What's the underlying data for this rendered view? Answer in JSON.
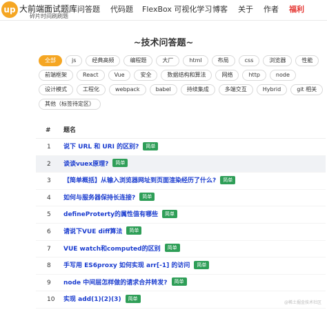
{
  "header": {
    "logo": "up",
    "site_title": "大前端面试题库",
    "site_subtitle": "碎片时间刷刷题",
    "nav": [
      "问答题",
      "代码题",
      "FlexBox 可视化学习",
      "博客",
      "关于",
      "作者",
      "福利"
    ],
    "active_color": "#e53935"
  },
  "page_title": "~技术问答题~",
  "tags": [
    "全部",
    "js",
    "经典高频",
    "编程题",
    "大厂",
    "html",
    "布局",
    "css",
    "浏览器",
    "性能",
    "前端框架",
    "React",
    "Vue",
    "安全",
    "数据结构和算法",
    "网络",
    "http",
    "node",
    "设计模式",
    "工程化",
    "webpack",
    "babel",
    "持续集成",
    "多端交互",
    "Hybrid",
    "git 相关",
    "其他（标签待定区）"
  ],
  "active_tag": "全部",
  "accent_color": "#f5a623",
  "table": {
    "headers": [
      "#",
      "题名"
    ],
    "badge_color": "#2e9e57",
    "rows": [
      {
        "num": "1",
        "title": "说下 URL 和 URI 的区别?",
        "badge": "简单"
      },
      {
        "num": "2",
        "title": "谈谈vuex原理?",
        "badge": "简单"
      },
      {
        "num": "3",
        "title": "【简单概括】从输入浏览器网址到页面渲染经历了什么?",
        "badge": "简单"
      },
      {
        "num": "4",
        "title": "如何与服务器保持长连接?",
        "badge": "简单"
      },
      {
        "num": "5",
        "title": "defineProterty的属性值有哪些",
        "badge": "简单"
      },
      {
        "num": "6",
        "title": "请说下VUE diff算法",
        "badge": "简单"
      },
      {
        "num": "7",
        "title": "VUE watch和computed的区别",
        "badge": "简单"
      },
      {
        "num": "8",
        "title": "手写用 ES6proxy 如何实现 arr[-1] 的访问",
        "badge": "简单"
      },
      {
        "num": "9",
        "title": "node 中间层怎样做的请求合并转发?",
        "badge": "简单"
      },
      {
        "num": "10",
        "title": "实现 add(1)(2)(3)",
        "badge": "简单"
      }
    ]
  },
  "watermark": "@稀土掘金技术社区"
}
